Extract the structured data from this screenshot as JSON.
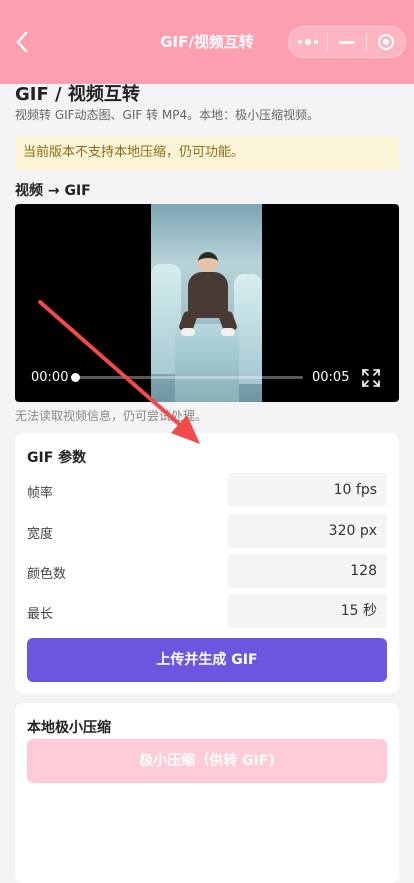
{
  "nav": {
    "title": "GIF/视频互转",
    "back_icon": "chevron-left-icon",
    "capsule": [
      "more-dots-icon",
      "minimize-icon",
      "close-target-icon"
    ],
    "bar_color": "#fe9fb0"
  },
  "page": {
    "title": "GIF / 视频互转",
    "subtitle": "视频转 GIF动态图、GIF 转 MP4。本地：极小压缩视频。",
    "warning": "当前版本不支持本地压缩，仍可功能。"
  },
  "video_section": {
    "heading": "视频 → GIF",
    "current_time": "00:00",
    "total_time": "00:05",
    "progress": 0.0,
    "hint": "无法读取视频信息，仍可尝试处理。"
  },
  "gif_params": {
    "title": "GIF 参数",
    "rows": [
      {
        "label": "帧率",
        "value": "10 fps"
      },
      {
        "label": "宽度",
        "value": "320 px"
      },
      {
        "label": "颜色数",
        "value": "128"
      },
      {
        "label": "最长",
        "value": "15 秒"
      }
    ],
    "submit_label": "上传并生成 GIF",
    "accent": "#6b56e0"
  },
  "compress": {
    "title": "本地极小压缩",
    "button_label": "极小压缩（供转 GIF)",
    "button_color": "#fdc7d2"
  }
}
